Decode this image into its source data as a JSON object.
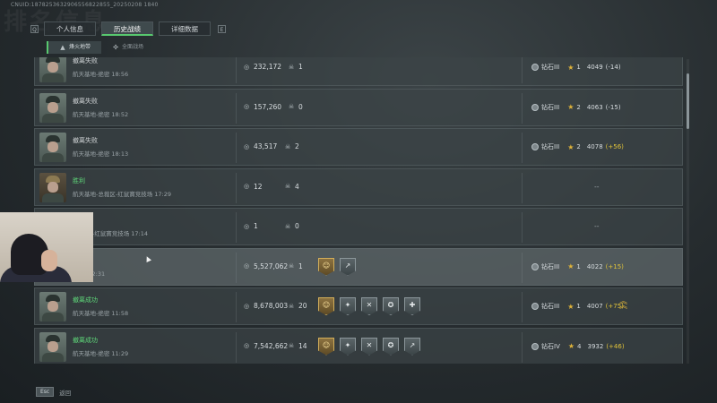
{
  "header": {
    "uid": "CNUID:1878253632906556822855_20250208 1840",
    "ghost_title": "排名信息",
    "kbd_left": "Q",
    "kbd_right": "E",
    "tabs": [
      {
        "label": "个人信息",
        "active": false
      },
      {
        "label": "历史战绩",
        "active": true
      },
      {
        "label": "详细数据",
        "active": false
      }
    ]
  },
  "subtabs": [
    {
      "label": "烽火地带",
      "active": true
    },
    {
      "label": "全面战场",
      "active": false
    }
  ],
  "rows": [
    {
      "result": "撤离失败",
      "result_style": "gray",
      "location": "航天基地-绝密 18:56",
      "money": "232,172",
      "kills": "1",
      "badges": [],
      "rank": "钻石III",
      "stars": "1",
      "score": "4049",
      "delta": "(-14)",
      "delta_positive": false,
      "highlight": false,
      "alt_avatar": false
    },
    {
      "result": "撤离失败",
      "result_style": "gray",
      "location": "航天基地-绝密 18:52",
      "money": "157,260",
      "kills": "0",
      "badges": [],
      "rank": "钻石III",
      "stars": "2",
      "score": "4063",
      "delta": "(-15)",
      "delta_positive": false,
      "highlight": false,
      "alt_avatar": false
    },
    {
      "result": "撤离失败",
      "result_style": "gray",
      "location": "航天基地-绝密 18:13",
      "money": "43,517",
      "kills": "2",
      "badges": [],
      "rank": "钻石III",
      "stars": "2",
      "score": "4078",
      "delta": "(+56)",
      "delta_positive": true,
      "highlight": false,
      "alt_avatar": false
    },
    {
      "result": "胜利",
      "result_style": "green",
      "location": "航天基地-总裁区-红鼠寶竞技场 17:29",
      "money": "12",
      "kills": "4",
      "badges": [],
      "rank": "",
      "stars": "",
      "score": "",
      "delta": "",
      "delta_positive": false,
      "dash": "--",
      "highlight": false,
      "alt_avatar": true
    },
    {
      "result": "",
      "result_style": "gray",
      "location": "-核心区-红鼠寶竞技场 17:14",
      "money": "1",
      "kills": "0",
      "badges": [],
      "rank": "",
      "stars": "",
      "score": "",
      "delta": "",
      "delta_positive": false,
      "dash": "--",
      "highlight": false,
      "alt_avatar": true
    },
    {
      "result": "",
      "result_style": "green",
      "location": "-绝密 12:31",
      "money": "5,527,062",
      "kills": "1",
      "badges": [
        {
          "icon": "☺",
          "gold": true
        },
        {
          "icon": "↗",
          "gold": false
        }
      ],
      "rank": "钻石III",
      "stars": "1",
      "score": "4022",
      "delta": "(+15)",
      "delta_positive": true,
      "highlight": true,
      "alt_avatar": false
    },
    {
      "result": "撤离成功",
      "result_style": "green",
      "location": "航天基地-绝密 11:58",
      "money": "8,678,003",
      "kills": "20",
      "badges": [
        {
          "icon": "☺",
          "gold": true
        },
        {
          "icon": "✦",
          "gold": false
        },
        {
          "icon": "✕",
          "gold": false
        },
        {
          "icon": "✪",
          "gold": false
        },
        {
          "icon": "✚",
          "gold": false
        }
      ],
      "rank": "钻石III",
      "stars": "1",
      "score": "4007",
      "delta": "(+75)",
      "delta_positive": true,
      "chevron": true,
      "highlight": false,
      "alt_avatar": false
    },
    {
      "result": "撤离成功",
      "result_style": "green",
      "location": "航天基地-绝密 11:29",
      "money": "7,542,662",
      "kills": "14",
      "badges": [
        {
          "icon": "☺",
          "gold": true
        },
        {
          "icon": "✦",
          "gold": false
        },
        {
          "icon": "✕",
          "gold": false
        },
        {
          "icon": "✪",
          "gold": false
        },
        {
          "icon": "↗",
          "gold": false
        }
      ],
      "rank": "钻石IV",
      "stars": "4",
      "score": "3932",
      "delta": "(+46)",
      "delta_positive": true,
      "highlight": false,
      "alt_avatar": false
    }
  ],
  "footer": {
    "esc_label": "Esc",
    "back_label": "返回"
  },
  "icons": {
    "money": "coin-icon",
    "kills": "skull-icon",
    "rank": "rank-emblem-icon",
    "star": "star-icon"
  },
  "colors": {
    "accent_green": "#58c96f",
    "gold": "#e0b43a"
  }
}
